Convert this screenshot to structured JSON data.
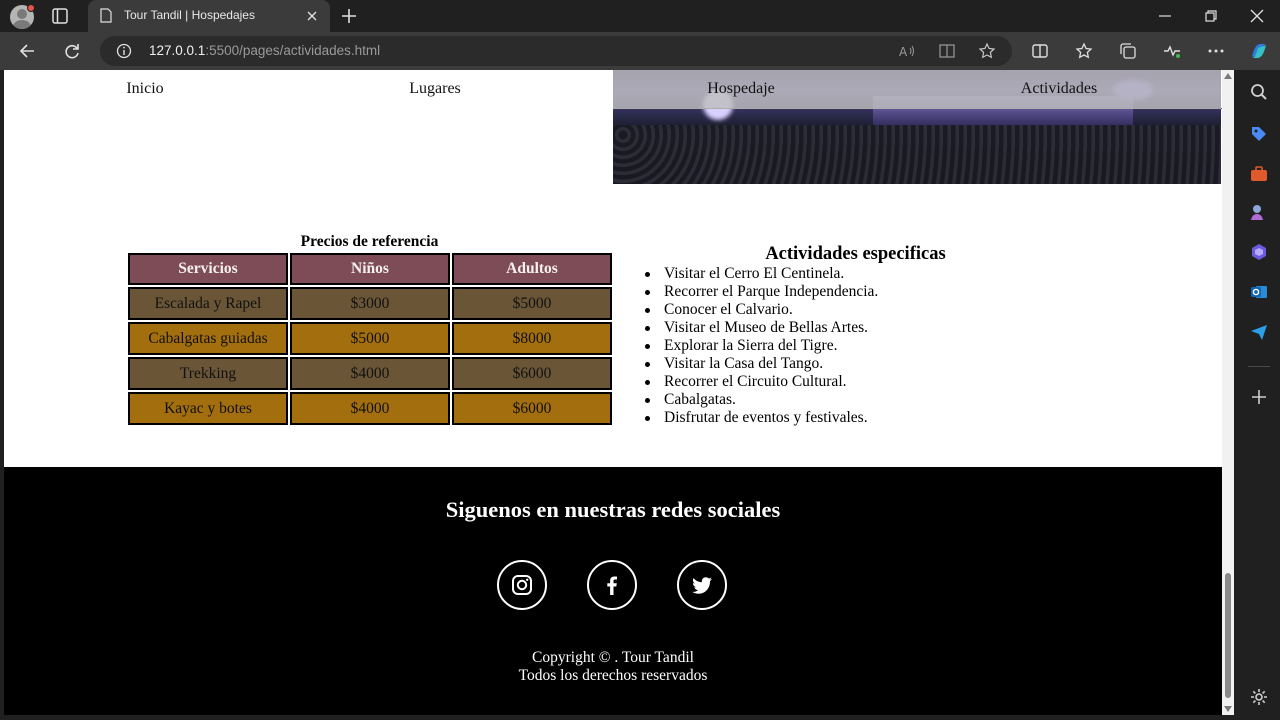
{
  "browser": {
    "tab_title": "Tour Tandil | Hospedajes",
    "url_host": "127.0.0.1",
    "url_rest": ":5500/pages/actividades.html"
  },
  "nav": {
    "items": [
      {
        "label": "Inicio"
      },
      {
        "label": "Lugares"
      },
      {
        "label": "Hospedaje"
      },
      {
        "label": "Actividades"
      }
    ]
  },
  "prices": {
    "caption": "Precios de referencia",
    "headers": [
      "Servicios",
      "Niños",
      "Adultos"
    ],
    "rows": [
      [
        "Escalada y Rapel",
        "$3000",
        "$5000"
      ],
      [
        "Cabalgatas guiadas",
        "$5000",
        "$8000"
      ],
      [
        "Trekking",
        "$4000",
        "$6000"
      ],
      [
        "Kayac y botes",
        "$4000",
        "$6000"
      ]
    ]
  },
  "activities": {
    "title": "Actividades especificas",
    "items": [
      "Visitar el Cerro El Centinela.",
      "Recorrer el Parque Independencia.",
      "Conocer el Calvario.",
      "Visitar el Museo de Bellas Artes.",
      "Explorar la Sierra del Tigre.",
      "Visitar la Casa del Tango.",
      "Recorrer el Circuito Cultural.",
      "Cabalgatas.",
      "Disfrutar de eventos y festivales."
    ]
  },
  "footer": {
    "title": "Siguenos en nuestras redes sociales",
    "social": [
      "instagram-icon",
      "facebook-icon",
      "twitter-icon"
    ],
    "copyright": "Copyright © . Tour Tandil",
    "rights": "Todos los derechos reservados"
  },
  "colors": {
    "header_bg": "#7d4c57",
    "row_dark": "#6a5636",
    "row_light": "#a36e0d",
    "footer_bg": "#000000"
  }
}
